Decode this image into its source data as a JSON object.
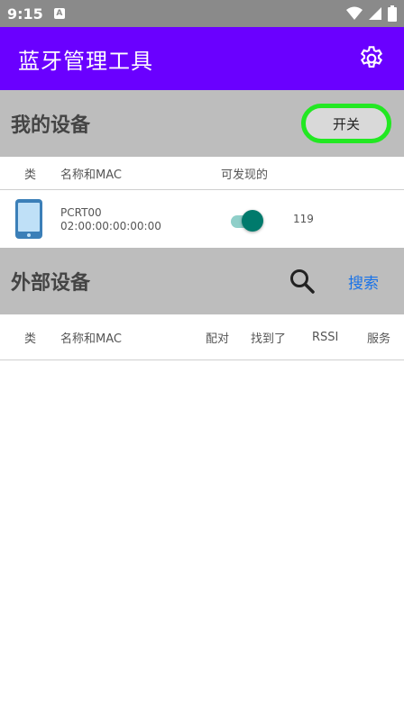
{
  "status_bar": {
    "time": "9:15",
    "notification_label": "A"
  },
  "app_bar": {
    "title": "蓝牙管理工具",
    "icon": "gear-icon"
  },
  "my_devices": {
    "heading": "我的设备",
    "toggle_label": "开关",
    "columns": {
      "type": "类",
      "name_mac": "名称和MAC",
      "discoverable": "可发现的"
    },
    "device": {
      "name": "PCRT00",
      "mac": "02:00:00:00:00:00",
      "value": "119",
      "discoverable_on": true
    }
  },
  "external_devices": {
    "heading": "外部设备",
    "search_label": "搜索",
    "columns": {
      "type": "类",
      "name_mac": "名称和MAC",
      "pair": "配对",
      "found": "找到了",
      "rssi": "RSSI",
      "service": "服务"
    }
  },
  "colors": {
    "accent": "#6a00ff",
    "toggle_border": "#22e822",
    "switch_on": "#007a6c",
    "link": "#1a73e8"
  }
}
